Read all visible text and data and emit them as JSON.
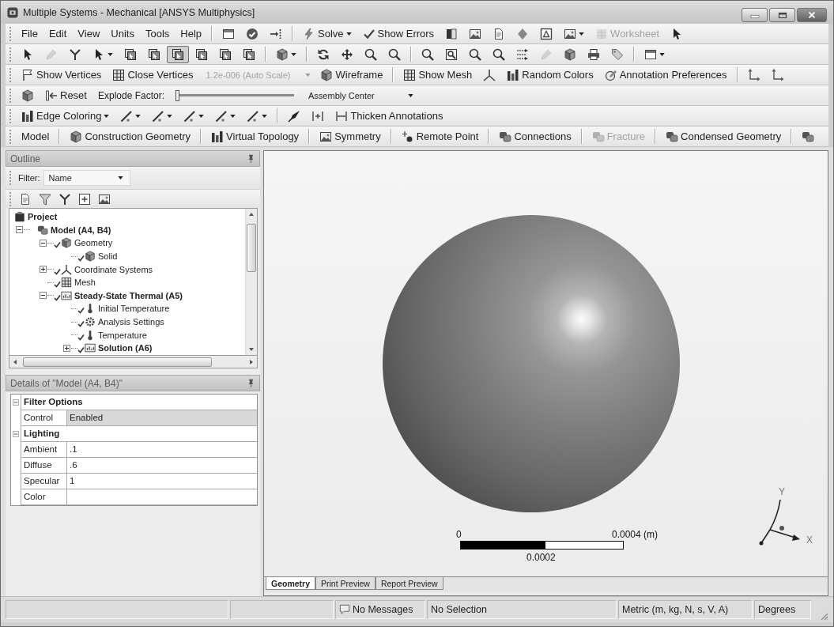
{
  "window": {
    "title": "Multiple Systems - Mechanical [ANSYS Multiphysics]"
  },
  "toolbars": [
    {
      "items": [
        {
          "kind": "menu",
          "label": "File",
          "disabled": false
        },
        {
          "kind": "menu",
          "label": "Edit",
          "disabled": false
        },
        {
          "kind": "menu",
          "label": "View",
          "disabled": false
        },
        {
          "kind": "menu",
          "label": "Units",
          "disabled": false
        },
        {
          "kind": "menu",
          "label": "Tools",
          "disabled": false
        },
        {
          "kind": "menu",
          "label": "Help",
          "disabled": false
        },
        {
          "kind": "sep"
        },
        {
          "kind": "icon",
          "disabled": false
        },
        {
          "kind": "icon",
          "disabled": false
        },
        {
          "kind": "icon",
          "disabled": false
        },
        {
          "kind": "sep"
        },
        {
          "kind": "button-menu",
          "label": "Solve",
          "disabled": false
        },
        {
          "kind": "button",
          "label": "Show Errors",
          "disabled": false
        },
        {
          "kind": "icon",
          "disabled": false
        },
        {
          "kind": "icon",
          "disabled": false
        },
        {
          "kind": "icon",
          "disabled": false
        },
        {
          "kind": "icon",
          "disabled": false
        },
        {
          "kind": "icon",
          "disabled": false
        },
        {
          "kind": "icon-menu",
          "disabled": false
        },
        {
          "kind": "button",
          "label": "Worksheet",
          "disabled": true
        },
        {
          "kind": "icon",
          "disabled": false
        }
      ]
    },
    {
      "items": [
        {
          "kind": "icon",
          "selected": false,
          "disabled": false
        },
        {
          "kind": "icon",
          "selected": false,
          "disabled": true
        },
        {
          "kind": "icon",
          "selected": false,
          "disabled": false
        },
        {
          "kind": "icon-menu",
          "selected": false,
          "disabled": false
        },
        {
          "kind": "icon",
          "selected": false,
          "disabled": false
        },
        {
          "kind": "icon",
          "selected": false,
          "disabled": false
        },
        {
          "kind": "icon",
          "selected": true,
          "disabled": false
        },
        {
          "kind": "icon",
          "selected": false,
          "disabled": false
        },
        {
          "kind": "icon",
          "selected": false,
          "disabled": false
        },
        {
          "kind": "icon",
          "selected": false,
          "disabled": false
        },
        {
          "kind": "sep"
        },
        {
          "kind": "icon-menu",
          "selected": false,
          "disabled": false
        },
        {
          "kind": "sep"
        },
        {
          "kind": "icon",
          "selected": false,
          "disabled": false
        },
        {
          "kind": "icon",
          "selected": false,
          "disabled": false
        },
        {
          "kind": "icon",
          "selected": false,
          "disabled": false
        },
        {
          "kind": "icon",
          "selected": false,
          "disabled": false
        },
        {
          "kind": "sep"
        },
        {
          "kind": "icon",
          "selected": false,
          "disabled": false
        },
        {
          "kind": "icon",
          "selected": false,
          "disabled": false
        },
        {
          "kind": "icon",
          "selected": false,
          "disabled": false
        },
        {
          "kind": "icon",
          "selected": false,
          "disabled": false
        },
        {
          "kind": "icon",
          "selected": false,
          "disabled": false
        },
        {
          "kind": "icon",
          "selected": false,
          "disabled": true
        },
        {
          "kind": "icon",
          "selected": false,
          "disabled": false
        },
        {
          "kind": "icon",
          "selected": false,
          "disabled": false
        },
        {
          "kind": "icon",
          "selected": false,
          "disabled": false
        },
        {
          "kind": "sep"
        },
        {
          "kind": "icon-menu",
          "selected": false,
          "disabled": false
        }
      ]
    },
    {
      "items": [
        {
          "kind": "button",
          "label": "Show Vertices",
          "disabled": false
        },
        {
          "kind": "button",
          "label": "Close Vertices",
          "disabled": false
        },
        {
          "kind": "combo",
          "label": "1.2e-006 (Auto Scale)",
          "disabled": true
        },
        {
          "kind": "button",
          "label": "Wireframe",
          "disabled": false
        },
        {
          "kind": "sep"
        },
        {
          "kind": "button",
          "label": "Show Mesh",
          "disabled": false
        },
        {
          "kind": "icon",
          "disabled": false
        },
        {
          "kind": "button",
          "label": "Random Colors",
          "disabled": false
        },
        {
          "kind": "button",
          "label": "Annotation Preferences",
          "disabled": false
        },
        {
          "kind": "sep"
        },
        {
          "kind": "icon",
          "disabled": false
        },
        {
          "kind": "icon",
          "disabled": false
        }
      ]
    },
    {
      "items": [
        {
          "kind": "icon"
        },
        {
          "kind": "button",
          "label": "Reset"
        },
        {
          "kind": "label",
          "label": "Explode Factor:"
        },
        {
          "kind": "slider",
          "level": 0
        },
        {
          "kind": "combo",
          "label": "Assembly Center"
        }
      ]
    },
    {
      "items": [
        {
          "kind": "button-menu",
          "label": "Edge Coloring"
        },
        {
          "kind": "icon-menu"
        },
        {
          "kind": "icon-menu"
        },
        {
          "kind": "icon-menu"
        },
        {
          "kind": "icon-menu"
        },
        {
          "kind": "icon-menu"
        },
        {
          "kind": "sep"
        },
        {
          "kind": "icon"
        },
        {
          "kind": "icon"
        },
        {
          "kind": "button",
          "label": "Thicken Annotations"
        }
      ]
    },
    {
      "items": [
        {
          "kind": "text-button",
          "label": "Model",
          "disabled": false
        },
        {
          "kind": "sep"
        },
        {
          "kind": "button",
          "label": "Construction Geometry",
          "disabled": false
        },
        {
          "kind": "sep"
        },
        {
          "kind": "button",
          "label": "Virtual Topology",
          "disabled": false
        },
        {
          "kind": "sep"
        },
        {
          "kind": "button",
          "label": "Symmetry",
          "disabled": false
        },
        {
          "kind": "sep"
        },
        {
          "kind": "button",
          "label": "Remote Point",
          "disabled": false
        },
        {
          "kind": "sep"
        },
        {
          "kind": "button",
          "label": "Connections",
          "disabled": false
        },
        {
          "kind": "sep"
        },
        {
          "kind": "button",
          "label": "Fracture",
          "disabled": true
        },
        {
          "kind": "sep"
        },
        {
          "kind": "button",
          "label": "Condensed Geometry",
          "disabled": false
        },
        {
          "kind": "sep"
        },
        {
          "kind": "icon",
          "disabled": false
        }
      ]
    }
  ],
  "outline": {
    "title": "Outline",
    "filter_label": "Filter:",
    "filter_value": "Name",
    "tree": [
      {
        "label": "Project",
        "kind": "project",
        "bold": true,
        "complete": false,
        "children": [
          {
            "label": "Model (A4, B4)",
            "kind": "model",
            "bold": true,
            "complete": false,
            "expanded": true,
            "children": [
              {
                "label": "Geometry",
                "kind": "part",
                "bold": false,
                "complete": true,
                "expanded": true,
                "children": [
                  {
                    "label": "Solid",
                    "kind": "body",
                    "bold": false,
                    "complete": true
                  }
                ]
              },
              {
                "label": "Coordinate Systems",
                "kind": "axes",
                "bold": false,
                "complete": true,
                "expanded": false
              },
              {
                "label": "Mesh",
                "kind": "mesh",
                "bold": false,
                "complete": true
              },
              {
                "label": "Steady-State Thermal (A5)",
                "kind": "analysis",
                "bold": true,
                "complete": true,
                "expanded": true,
                "children": [
                  {
                    "label": "Initial Temperature",
                    "kind": "load",
                    "bold": false,
                    "complete": true
                  },
                  {
                    "label": "Analysis Settings",
                    "kind": "settings",
                    "bold": false,
                    "complete": true
                  },
                  {
                    "label": "Temperature",
                    "kind": "load",
                    "bold": false,
                    "complete": true
                  },
                  {
                    "label": "Solution (A6)",
                    "kind": "solution",
                    "bold": true,
                    "complete": true,
                    "expanded": false
                  }
                ]
              }
            ]
          }
        ]
      }
    ]
  },
  "details": {
    "title": "Details of \"Model (A4, B4)\"",
    "groups": [
      {
        "title": "Filter Options",
        "expanded": true,
        "rows": [
          {
            "name": "Control",
            "value": "Enabled",
            "read_only": true
          }
        ]
      },
      {
        "title": "Lighting",
        "expanded": true,
        "rows": [
          {
            "name": "Ambient",
            "value": ".1",
            "read_only": false
          },
          {
            "name": "Diffuse",
            "value": ".6",
            "read_only": false
          },
          {
            "name": "Specular",
            "value": "1",
            "read_only": false
          },
          {
            "name": "Color",
            "read_only": false
          }
        ]
      }
    ]
  },
  "viewport": {
    "scale_bar": {
      "start": "0",
      "end": "0.0004 (m)",
      "middle": "0.0002"
    },
    "triad": {
      "y_label": "Y",
      "x_label": "X"
    },
    "tabs": [
      {
        "label": "Geometry",
        "selected": true
      },
      {
        "label": "Print Preview",
        "selected": false
      },
      {
        "label": "Report Preview",
        "selected": false
      }
    ]
  },
  "status_bar": {
    "messages": "No Messages",
    "selection": "No Selection",
    "units": "Metric (m, kg, N, s, V, A)",
    "angle": "Degrees"
  }
}
